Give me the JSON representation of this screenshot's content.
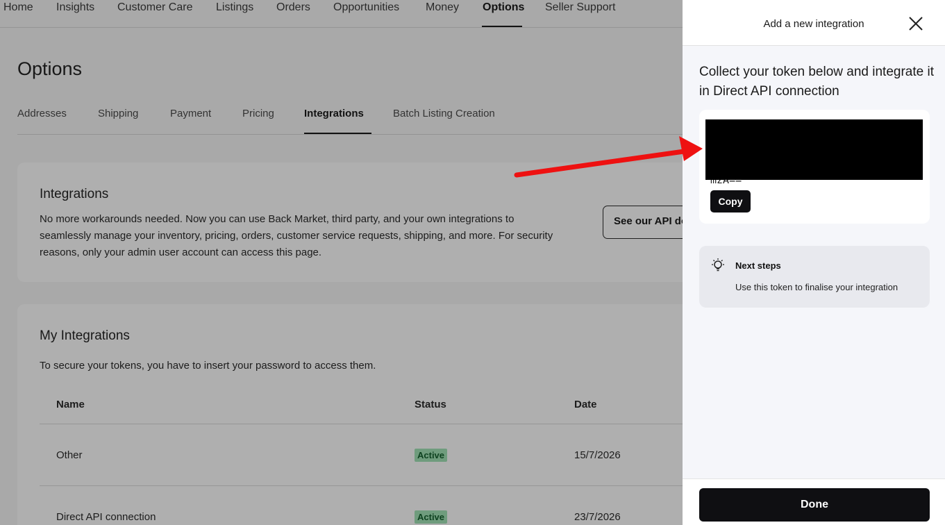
{
  "topnav": {
    "items": [
      "Home",
      "Insights",
      "Customer Care",
      "Listings",
      "Orders",
      "Opportunities",
      "Money",
      "Options",
      "Seller Support"
    ],
    "active": "Options"
  },
  "page": {
    "title": "Options",
    "subtabs": [
      "Addresses",
      "Shipping",
      "Payment",
      "Pricing",
      "Integrations",
      "Batch Listing Creation"
    ],
    "active_subtab": "Integrations"
  },
  "integrations_card": {
    "title": "Integrations",
    "description": "No more workarounds needed. Now you can use Back Market, third party, and your own integrations to seamlessly manage your inventory, pricing, orders, customer service requests, shipping, and more. For security reasons, only your admin user account can access this page.",
    "api_button": "See our API do"
  },
  "my_integrations": {
    "title": "My Integrations",
    "note": "To secure your tokens, you have to insert your password to access them.",
    "columns": [
      "Name",
      "Status",
      "Date"
    ],
    "rows": [
      {
        "name": "Other",
        "status": "Active",
        "date": "15/7/2026"
      },
      {
        "name": "Direct API connection",
        "status": "Active",
        "date": "23/7/2026"
      }
    ]
  },
  "drawer": {
    "title": "Add a new integration",
    "heading": "Collect your token below and integrate it in Direct API connection",
    "token_visible_tail": "mzA==",
    "copy_label": "Copy",
    "next_steps_title": "Next steps",
    "next_steps_text": "Use this token to finalise your integration",
    "done_label": "Done"
  },
  "colors": {
    "accent_dark": "#0f0f12",
    "status_active_bg": "#9fe3b3",
    "annotation_arrow": "#ee1111"
  },
  "icons": [
    "close-icon",
    "lightbulb-icon"
  ]
}
